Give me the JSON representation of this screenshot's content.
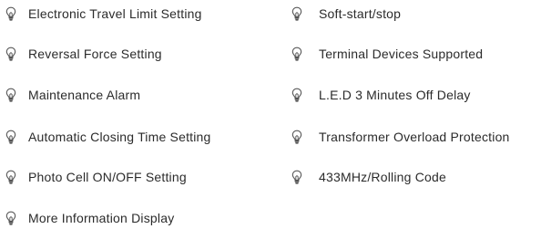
{
  "icon": "lightbulb-icon",
  "left_features": [
    "Electronic Travel Limit Setting",
    "Reversal Force Setting",
    "Maintenance Alarm",
    "Automatic Closing Time Setting",
    "Photo Cell ON/OFF Setting",
    "More Information Display"
  ],
  "right_features": [
    "Soft-start/stop",
    "Terminal Devices Supported",
    "L.E.D 3 Minutes Off Delay",
    "Transformer Overload Protection",
    "433MHz/Rolling Code"
  ]
}
